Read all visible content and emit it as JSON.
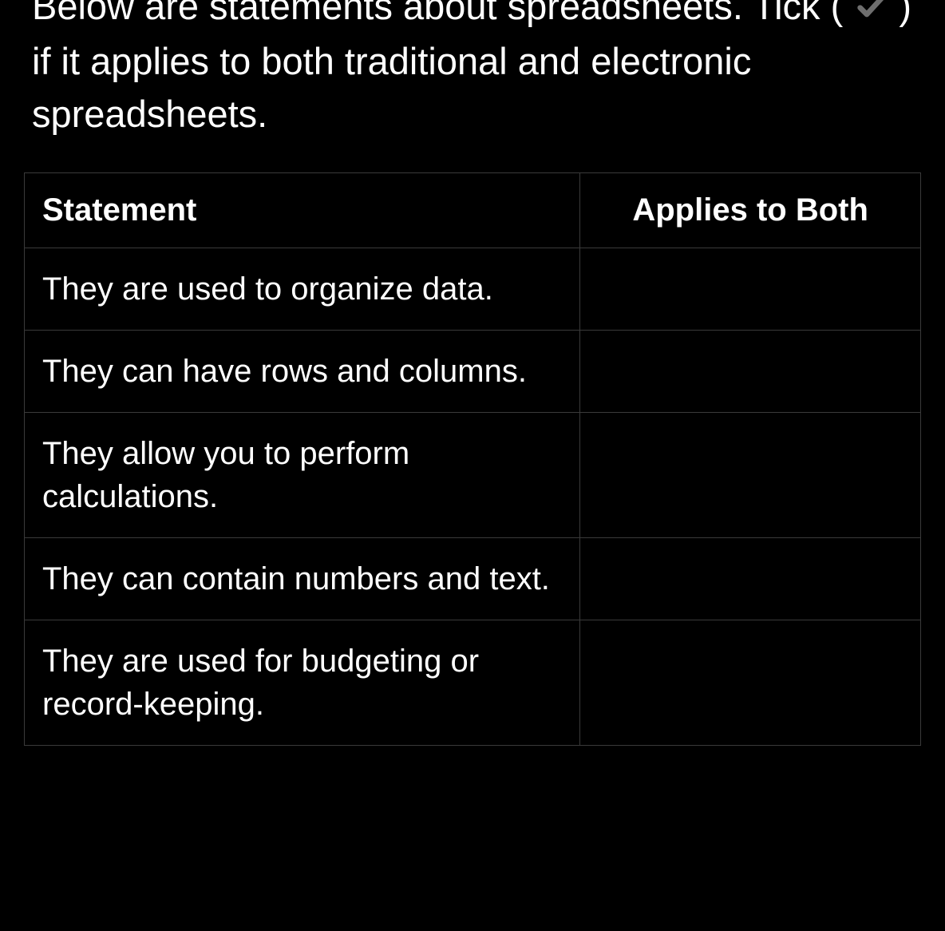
{
  "instruction": {
    "text_before": "Below are statements about spreadsheets. Tick (",
    "text_after": ") if it applies to both traditional and electronic spreadsheets."
  },
  "table": {
    "headers": {
      "statement": "Statement",
      "applies": "Applies to Both"
    },
    "rows": [
      {
        "statement": "They are used to organize data.",
        "applies": ""
      },
      {
        "statement": "They can have rows and columns.",
        "applies": ""
      },
      {
        "statement": "They allow you to perform calculations.",
        "applies": ""
      },
      {
        "statement": "They can contain numbers and text.",
        "applies": ""
      },
      {
        "statement": "They are used for budgeting or record-keeping.",
        "applies": ""
      }
    ]
  }
}
